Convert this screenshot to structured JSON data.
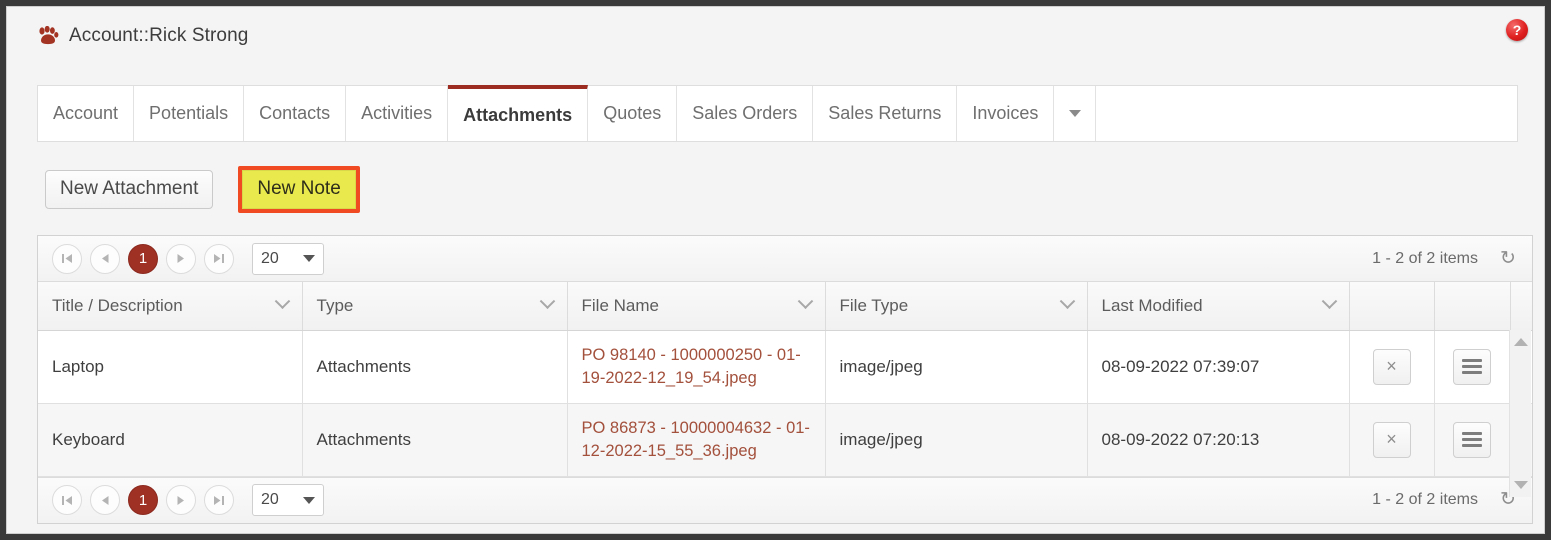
{
  "header": {
    "icon": "paw-icon",
    "title": "Account::Rick Strong",
    "help_icon_label": "?"
  },
  "tabs": [
    {
      "label": "Account",
      "active": false
    },
    {
      "label": "Potentials",
      "active": false
    },
    {
      "label": "Contacts",
      "active": false
    },
    {
      "label": "Activities",
      "active": false
    },
    {
      "label": "Attachments",
      "active": true
    },
    {
      "label": "Quotes",
      "active": false
    },
    {
      "label": "Sales Orders",
      "active": false
    },
    {
      "label": "Sales Returns",
      "active": false
    },
    {
      "label": "Invoices",
      "active": false
    }
  ],
  "tab_overflow_icon": "chevron-down-icon",
  "actions": {
    "new_attachment_label": "New Attachment",
    "new_note_label": "New Note",
    "highlight_color": "#f04a23",
    "highlight_fill": "#e9e94e"
  },
  "pager": {
    "first_icon": "⏮",
    "prev_icon": "◀",
    "current_page": "1",
    "next_icon": "▶",
    "last_icon": "⏭",
    "page_size": "20",
    "items_info": "1 - 2 of 2 items",
    "refresh_icon": "↻"
  },
  "table": {
    "columns": [
      "Title / Description",
      "Type",
      "File Name",
      "File Type",
      "Last Modified"
    ],
    "rows": [
      {
        "title": "Laptop",
        "type": "Attachments",
        "file_name": "PO 98140 - 1000000250 - 01-19-2022-12_19_54.jpeg",
        "file_type": "image/jpeg",
        "last_modified": "08-09-2022 07:39:07",
        "delete_icon": "×",
        "menu_icon": "hamburger-icon"
      },
      {
        "title": "Keyboard",
        "type": "Attachments",
        "file_name": "PO 86873 - 10000004632 - 01-12-2022-15_55_36.jpeg",
        "file_type": "image/jpeg",
        "last_modified": "08-09-2022 07:20:13",
        "delete_icon": "×",
        "menu_icon": "hamburger-icon"
      }
    ]
  },
  "theme": {
    "accent": "#9e3024",
    "link": "#a3503c",
    "page_bg": "#f4f4f4"
  }
}
